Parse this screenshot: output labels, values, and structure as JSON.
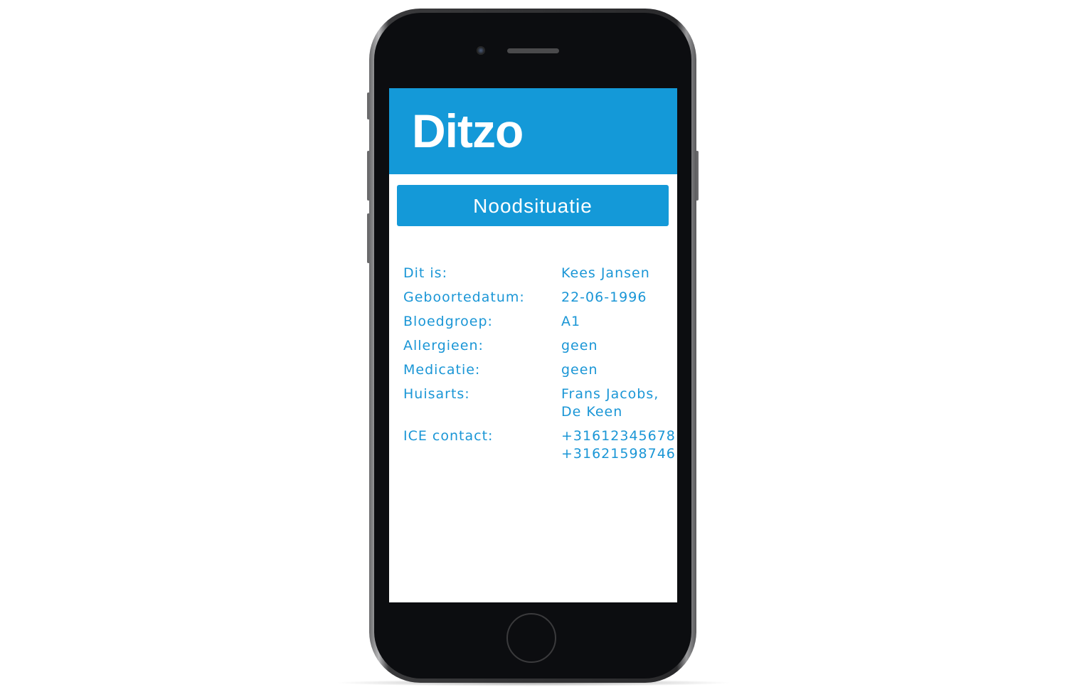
{
  "app": {
    "logo": "Ditzo",
    "brand_color": "#1499d8"
  },
  "emergency_button": {
    "label": "Noodsituatie"
  },
  "info": [
    {
      "label": "Dit is:",
      "values": [
        "Kees Jansen"
      ]
    },
    {
      "label": "Geboortedatum:",
      "values": [
        "22-06-1996"
      ]
    },
    {
      "label": "Bloedgroep:",
      "values": [
        "A1"
      ]
    },
    {
      "label": "Allergieen:",
      "values": [
        "geen"
      ]
    },
    {
      "label": "Medicatie:",
      "values": [
        "geen"
      ]
    },
    {
      "label": "Huisarts:",
      "values": [
        "Frans Jacobs,",
        "De Keen"
      ]
    },
    {
      "label": "ICE contact:",
      "values": [
        "+31612345678",
        "+31621598746"
      ]
    }
  ]
}
